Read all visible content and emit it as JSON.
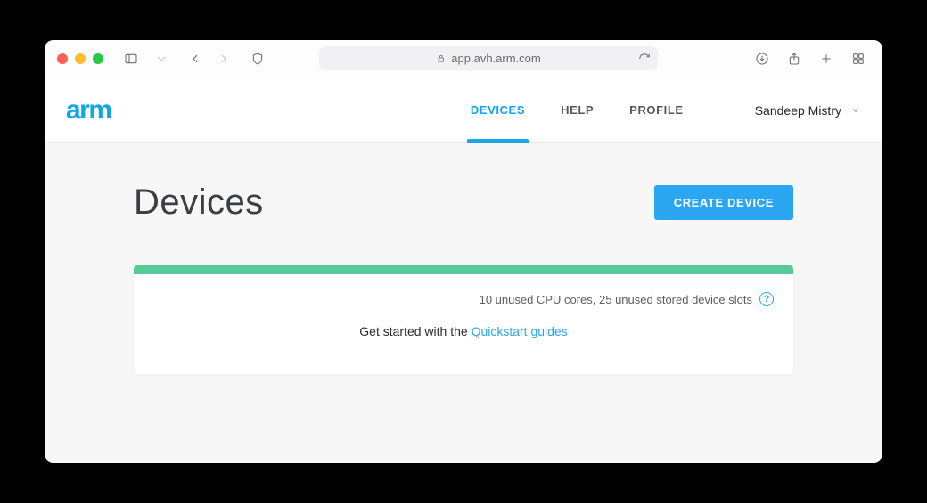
{
  "browser": {
    "url": "app.avh.arm.com"
  },
  "logo_text": "arm",
  "nav": {
    "devices": "DEVICES",
    "help": "HELP",
    "profile": "PROFILE"
  },
  "user": {
    "display_name": "Sandeep Mistry"
  },
  "page": {
    "title": "Devices",
    "create_label": "CREATE DEVICE"
  },
  "usage": {
    "text": "10 unused CPU cores, 25 unused stored device slots"
  },
  "getting_started": {
    "prefix": "Get started with the ",
    "link_text": "Quickstart guides"
  }
}
